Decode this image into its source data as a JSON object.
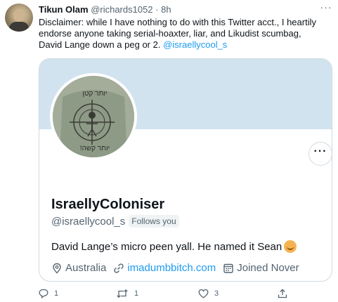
{
  "tweet": {
    "author_name": "Tikun Olam",
    "author_meta": "@richards1052 · 8h",
    "text": "Disclaimer: while I have nothing to do with this Twitter acct., I heartily endorse anyone taking serial-hoaxter, liar, and Likudist scumbag, David Lange down a peg or 2. ",
    "mention": "@israellycool_s",
    "more_icon": "more-horizontal-icon"
  },
  "card": {
    "profile_shirt_text_top": "יותר קטן",
    "profile_shirt_text_bottom": "יותר קשה!",
    "display_name": "IsraellyColoniser",
    "handle": "@israellycool_s",
    "follows_you": "Follows you",
    "bio": "David Lange’s micro peen yall. He named it Sean",
    "location": "Australia",
    "website": "imadumbbitch.com",
    "joined": "Joined Nover",
    "more_icon": "more-horizontal-icon"
  },
  "actions": {
    "reply_count": "1",
    "retweet_count": "1",
    "like_count": "3"
  },
  "colors": {
    "accent": "#1d9bf0",
    "secondary_text": "#536471",
    "banner": "#d2e3f0",
    "border": "#cfd9de"
  }
}
